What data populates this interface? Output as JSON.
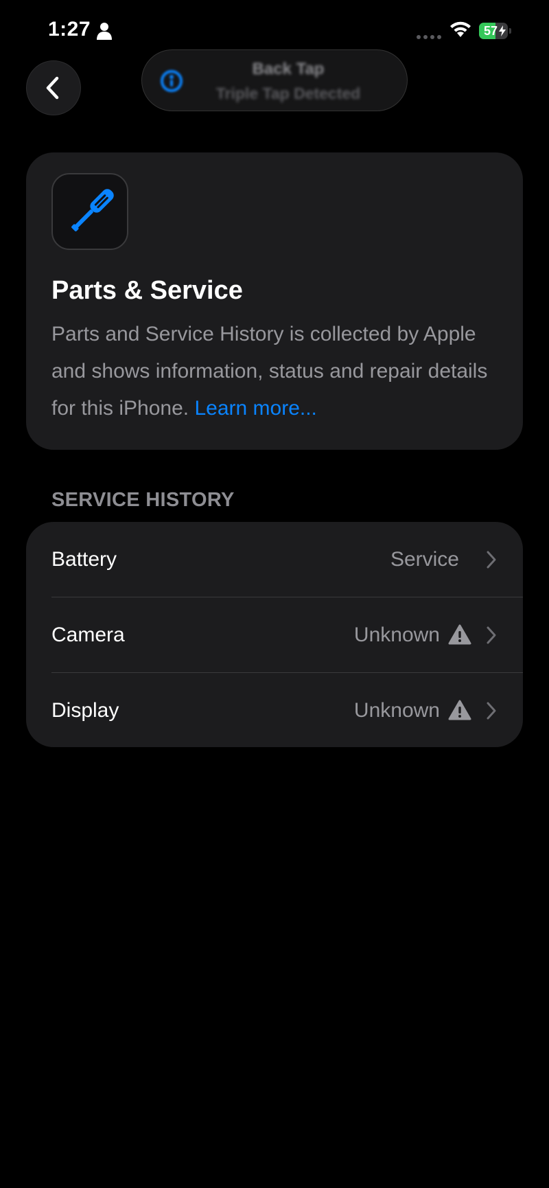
{
  "status_bar": {
    "time": "1:27",
    "battery_percent": "57",
    "battery_level": 0.57,
    "battery_color": "#34c759",
    "icons": [
      "person-icon",
      "cellular-dots-icon",
      "wifi-icon",
      "battery-icon",
      "charging-bolt-icon"
    ]
  },
  "nav": {
    "back_icon": "chevron-left-icon"
  },
  "notification": {
    "title": "Back Tap",
    "subtitle": "Triple Tap Detected",
    "icon": "accessibility-icon"
  },
  "info_card": {
    "icon": "screwdriver-icon",
    "icon_color": "#0a84ff",
    "title": "Parts & Service",
    "description": "Parts and Service History is collected by Apple and shows information, status and repair details for this iPhone.",
    "learn_more": "Learn more..."
  },
  "service_history": {
    "header": "SERVICE HISTORY",
    "items": [
      {
        "label": "Battery",
        "value": "Service",
        "warning": false
      },
      {
        "label": "Camera",
        "value": "Unknown",
        "warning": true
      },
      {
        "label": "Display",
        "value": "Unknown",
        "warning": true
      }
    ]
  },
  "colors": {
    "background": "#000000",
    "card": "#1c1c1e",
    "link": "#0a84ff",
    "secondary_text": "#98989d"
  }
}
